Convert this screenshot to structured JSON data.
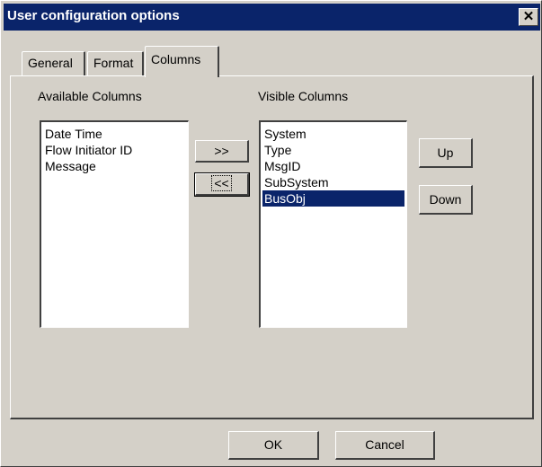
{
  "window": {
    "title": "User configuration options",
    "close_label": "✕"
  },
  "tabs": [
    {
      "label": "General",
      "active": false
    },
    {
      "label": "Format",
      "active": false
    },
    {
      "label": "Columns",
      "active": true
    }
  ],
  "available": {
    "label": "Available Columns",
    "items": [
      "Date Time",
      "Flow Initiator ID",
      "Message"
    ]
  },
  "visible": {
    "label": "Visible Columns",
    "items": [
      "System",
      "Type",
      "MsgID",
      "SubSystem",
      "BusObj"
    ],
    "selected_index": 4
  },
  "buttons": {
    "add": ">>",
    "remove": "<<",
    "up": "Up",
    "down": "Down",
    "ok": "OK",
    "cancel": "Cancel"
  },
  "colors": {
    "face": "#d4d0c8",
    "titlebar": "#0a246a",
    "selection": "#0a246a"
  }
}
